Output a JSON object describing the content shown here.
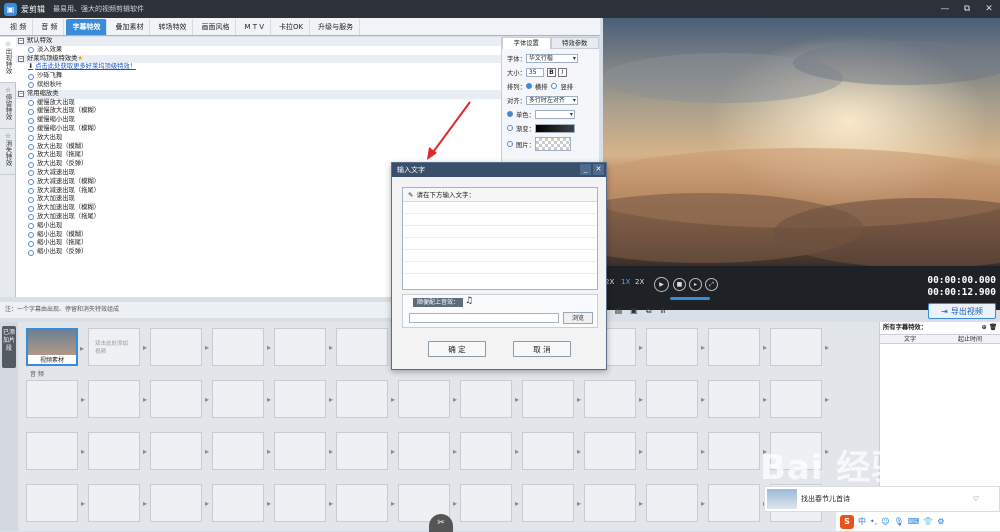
{
  "app": {
    "name": "爱剪辑",
    "slogan": "最易用、强大的视频剪辑软件"
  },
  "window_controls": [
    "—",
    "⧉",
    "✕"
  ],
  "tabs": [
    {
      "label": "视 频"
    },
    {
      "label": "音 频"
    },
    {
      "label": "字幕特效"
    },
    {
      "label": "叠加素材"
    },
    {
      "label": "转场特效"
    },
    {
      "label": "画面风格"
    },
    {
      "label": "M T V"
    },
    {
      "label": "卡拉OK"
    },
    {
      "label": "升级与服务"
    }
  ],
  "side_tabs": [
    "出现特效",
    "停留特效",
    "消失特效"
  ],
  "effects": {
    "group1": "默认特效",
    "group1_item": "淡入效果",
    "group2": "好莱坞顶级特效类",
    "group2_link": "点击此处获取更多好莱坞顶级特效！",
    "group2_items": [
      "沙砾飞舞",
      "缤纷秋叶"
    ],
    "group3": "常用缩放类",
    "group3_items": [
      "缓慢放大出现",
      "缓慢放大出现（模糊）",
      "缓慢缩小出现",
      "缓慢缩小出现（模糊）",
      "放大出现",
      "放大出现（模糊）",
      "放大出现（拖尾）",
      "放大出现（反弹）",
      "放大减速出现",
      "放大减速出现（模糊）",
      "放大减速出现（拖尾）",
      "放大加速出现",
      "放大加速出现（模糊）",
      "放大加速出现（拖尾）",
      "缩小出现",
      "缩小出现（模糊）",
      "缩小出现（拖尾）",
      "缩小出现（反弹）"
    ]
  },
  "props": {
    "tab_font": "字体设置",
    "tab_effect": "特效参数",
    "font_label": "字体：",
    "font_value": "华文行楷",
    "size_label": "大小：",
    "size_value": "35",
    "bold": "B",
    "italic": "I",
    "layout_label": "排列：",
    "layout_h": "横排",
    "layout_v": "竖排",
    "align_label": "对齐：",
    "align_value": "多行时左对齐",
    "single_color": "单色：",
    "gradient": "渐变：",
    "image": "图片："
  },
  "player": {
    "speeds": [
      "2X",
      "1X",
      "2X"
    ],
    "time_current": "00:00:00.000",
    "time_total": "00:00:12.900"
  },
  "note": "注：一个字幕由出现、停留和消失特效组成",
  "export_button": "导出视频",
  "timeline": {
    "side_label": "已添加片段",
    "clip_label": "视频素材",
    "add_hint": "双击此处添加视频",
    "audio_label": "音 频"
  },
  "right_panel": {
    "title": "所有字幕特效：",
    "col_text": "文字",
    "col_time": "起止时间"
  },
  "dialog": {
    "title": "输入文字",
    "prompt": "请在下方输入文字：",
    "music_label": "顺便配上音效：",
    "browse": "浏览",
    "ok": "确 定",
    "cancel": "取 消",
    "ctrl_min": "_",
    "ctrl_close": "✕"
  },
  "ad": {
    "text": "找出春节儿首诗"
  },
  "ime": {
    "logo": "S",
    "mode": "中"
  },
  "watermark": "Bai 经验",
  "colors": {
    "accent": "#3a8bd8",
    "titlebar": "#2d3138"
  }
}
